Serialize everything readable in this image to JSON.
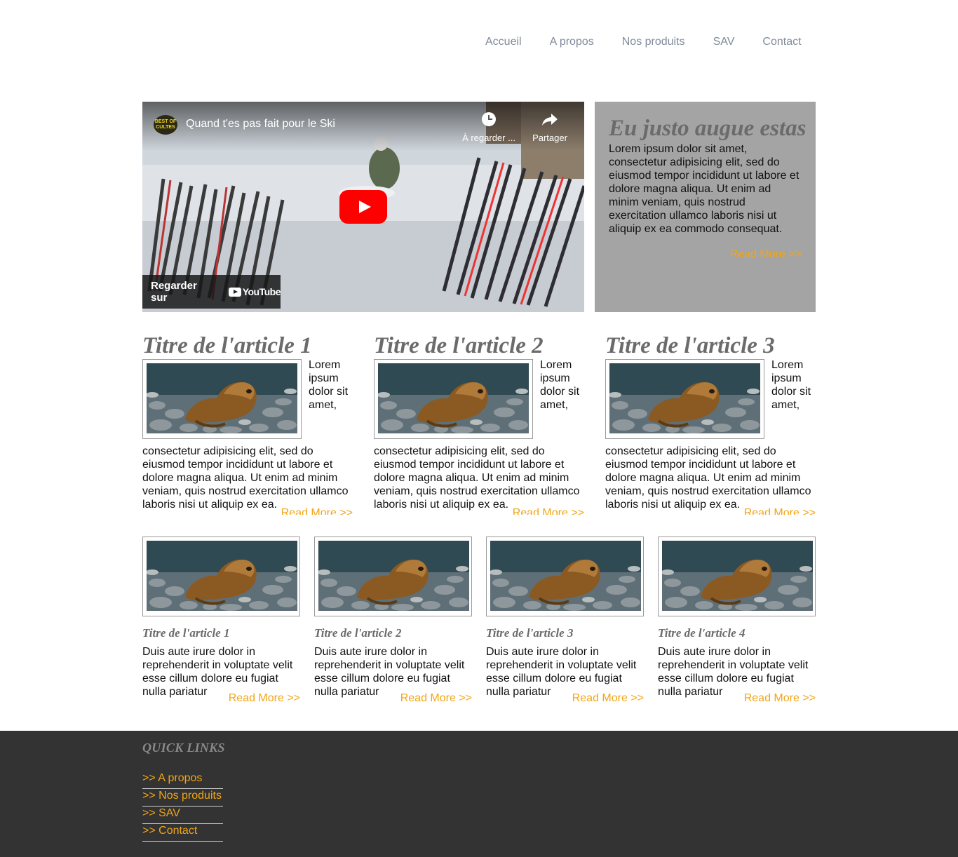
{
  "nav": {
    "items": [
      "Accueil",
      "A propos",
      "Nos produits",
      "SAV",
      "Contact"
    ]
  },
  "video": {
    "channel_badge": "BEST OF CULTES",
    "title": "Quand t'es pas fait pour le Ski",
    "watch_later_label": "À regarder ...",
    "share_label": "Partager",
    "watch_on_label": "Regarder sur",
    "platform": "YouTube"
  },
  "feature": {
    "title": "Eu justo augue estas",
    "text": "Lorem ipsum dolor sit amet, consectetur adipisicing elit, sed do eiusmod tempor incididunt ut labore et dolore magna aliqua. Ut enim ad minim veniam, quis nostrud exercitation ullamco laboris nisi ut aliquip ex ea commodo consequat.",
    "read_more": "Read More >>"
  },
  "articles": [
    {
      "title": "Titre de l'article 1",
      "text": "Lorem ipsum dolor sit amet, consectetur adipisicing elit, sed do eiusmod tempor incididunt ut labore et dolore magna aliqua. Ut enim ad minim veniam, quis nostrud exercitation ullamco laboris nisi ut aliquip ex ea.",
      "read_more": "Read More >>"
    },
    {
      "title": "Titre de l'article 2",
      "text": "Lorem ipsum dolor sit amet, consectetur adipisicing elit, sed do eiusmod tempor incididunt ut labore et dolore magna aliqua. Ut enim ad minim veniam, quis nostrud exercitation ullamco laboris nisi ut aliquip ex ea.",
      "read_more": "Read More >>"
    },
    {
      "title": "Titre de l'article 3",
      "text": "Lorem ipsum dolor sit amet, consectetur adipisicing elit, sed do eiusmod tempor incididunt ut labore et dolore magna aliqua. Ut enim ad minim veniam, quis nostrud exercitation ullamco laboris nisi ut aliquip ex ea.",
      "read_more": "Read More >>"
    }
  ],
  "cards": [
    {
      "title": "Titre de l'article 1",
      "text": "Duis aute irure dolor in reprehenderit in voluptate velit esse cillum dolore eu fugiat nulla pariatur",
      "read_more": "Read More >>"
    },
    {
      "title": "Titre de l'article 2",
      "text": "Duis aute irure dolor in reprehenderit in voluptate velit esse cillum dolore eu fugiat nulla pariatur",
      "read_more": "Read More >>"
    },
    {
      "title": "Titre de l'article 3",
      "text": "Duis aute irure dolor in reprehenderit in voluptate velit esse cillum dolore eu fugiat nulla pariatur",
      "read_more": "Read More >>"
    },
    {
      "title": "Titre de l'article 4",
      "text": "Duis aute irure dolor in reprehenderit in voluptate velit esse cillum dolore eu fugiat nulla pariatur",
      "read_more": "Read More >>"
    }
  ],
  "footer": {
    "heading": "QUICK LINKS",
    "links": [
      ">> A propos",
      ">> Nos produits",
      ">> SAV",
      ">> Contact"
    ]
  },
  "colors": {
    "nav_link": "#7f8b9b",
    "accent": "#f2a516",
    "heading_gray": "#6b6b6b",
    "feature_bg": "#a4a4a4",
    "footer_bg": "#333333",
    "play_button": "#ff0000"
  },
  "icons": {
    "watch_later": "clock-icon",
    "share": "share-icon",
    "play": "play-icon"
  }
}
